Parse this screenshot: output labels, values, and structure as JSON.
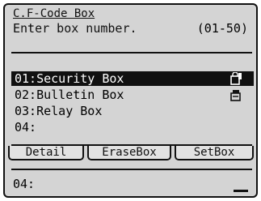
{
  "header": {
    "title": "C.F-Code Box",
    "prompt": "Enter box number.",
    "range": "(01-50)"
  },
  "list": {
    "items": [
      {
        "label": "01:Security Box",
        "selected": true,
        "icon": "locked-box-icon"
      },
      {
        "label": "02:Bulletin Box",
        "selected": false,
        "icon": "bulletin-box-icon"
      },
      {
        "label": "03:Relay Box",
        "selected": false,
        "icon": ""
      },
      {
        "label": "04:",
        "selected": false,
        "icon": ""
      }
    ]
  },
  "softkeys": {
    "detail": "Detail",
    "erase_box": "EraseBox",
    "set_box": "SetBox"
  },
  "input": {
    "value": "04:"
  },
  "colors": {
    "background": "#ececec",
    "foreground": "#111111",
    "highlight_text": "#ffffff"
  }
}
